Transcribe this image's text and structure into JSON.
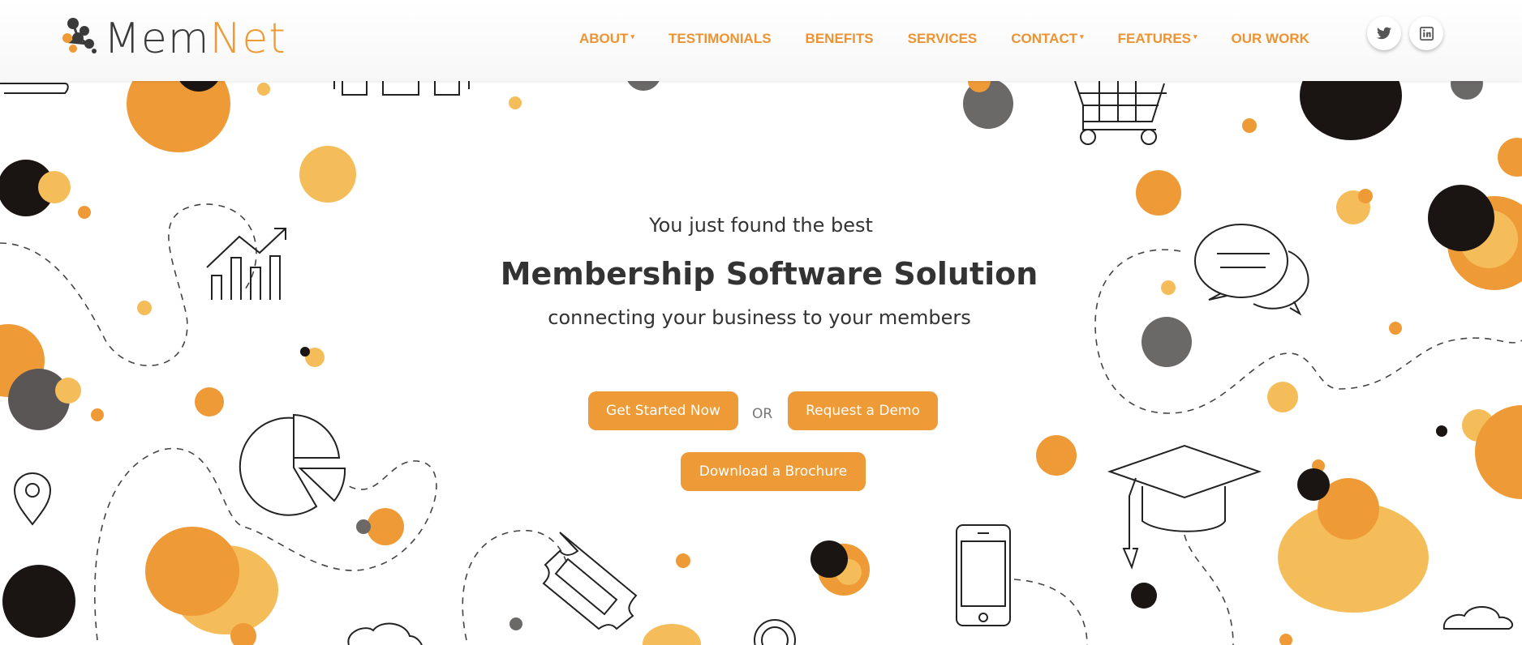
{
  "brand": {
    "name_part1": "Mem",
    "name_part2": "Net"
  },
  "nav": {
    "items": [
      {
        "label": "ABOUT",
        "dropdown": true
      },
      {
        "label": "TESTIMONIALS",
        "dropdown": false
      },
      {
        "label": "BENEFITS",
        "dropdown": false
      },
      {
        "label": "SERVICES",
        "dropdown": false
      },
      {
        "label": "CONTACT",
        "dropdown": true
      },
      {
        "label": "FEATURES",
        "dropdown": true
      },
      {
        "label": "OUR WORK",
        "dropdown": false
      }
    ],
    "caret_glyph": "▾"
  },
  "social": {
    "icons": [
      "twitter-icon",
      "linkedin-icon"
    ]
  },
  "hero": {
    "intro": "You just found the best",
    "title": "Membership Software Solution",
    "subtitle": "connecting your business to your members",
    "primary_button": "Get Started Now",
    "or_label": "OR",
    "demo_button": "Request a Demo",
    "brochure_button": "Download a Brochure"
  },
  "colors": {
    "accent": "#ee9a36",
    "light_orange": "#f5bd5a",
    "dark": "#1a1412",
    "gray": "#6b6868",
    "text": "#333333"
  }
}
